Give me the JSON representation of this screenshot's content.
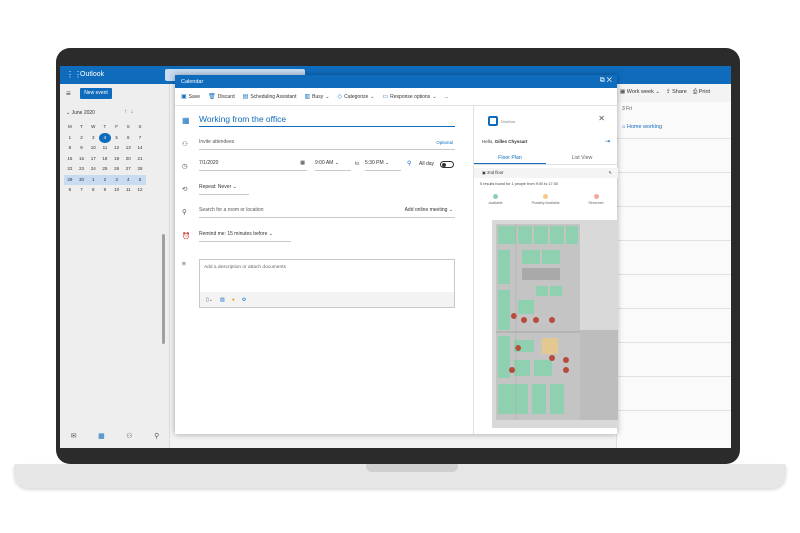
{
  "outlook": {
    "app_name": "Outlook",
    "new_event_label": "New event",
    "month_label": "June 2020",
    "weekdays": [
      "M",
      "T",
      "W",
      "T",
      "F",
      "S",
      "S"
    ],
    "weeks": [
      [
        "1",
        "2",
        "3",
        "4",
        "5",
        "6",
        "7"
      ],
      [
        "8",
        "9",
        "10",
        "11",
        "12",
        "13",
        "14"
      ],
      [
        "15",
        "16",
        "17",
        "18",
        "19",
        "20",
        "21"
      ],
      [
        "22",
        "23",
        "24",
        "25",
        "26",
        "27",
        "28"
      ],
      [
        "29",
        "30",
        "1",
        "2",
        "3",
        "4",
        "5"
      ],
      [
        "6",
        "7",
        "8",
        "9",
        "10",
        "11",
        "12"
      ]
    ],
    "today": "4",
    "view_label": "Work week",
    "share_label": "Share",
    "print_label": "Print",
    "day_label": "3 Fri",
    "home_working_label": "Home working"
  },
  "modal": {
    "window_title": "Calendar",
    "toolbar": {
      "save": "Save",
      "discard": "Discard",
      "scheduling": "Scheduling Assistant",
      "busy": "Busy",
      "categorize": "Categorize",
      "response": "Response options",
      "more": "..."
    },
    "form": {
      "title": "Working from the office",
      "attendees_placeholder": "Invite attendees",
      "optional_label": "Optional",
      "date": "7/1/2020",
      "start_time": "9:00 AM",
      "to_label": "to",
      "end_time": "5:30 PM",
      "all_day_label": "All day",
      "repeat_label": "Repeat: Never",
      "location_placeholder": "Search for a room or location",
      "online_meeting_label": "Add online meeting",
      "remind_label": "Remind me: 15 minutes before",
      "description_placeholder": "Add a description or attach documents"
    }
  },
  "panel": {
    "logo_text": "Deskflow",
    "greeting": "Hello,",
    "user_name": "Gilles Chyssart",
    "tabs": [
      "Floor Plan",
      "List View"
    ],
    "active_tab": 0,
    "floor_label": "2nd floor",
    "results_text": "5 results found for 1 people from 9:00 to 17:30",
    "legend": [
      {
        "label": "Available",
        "color": "#8fd0b0"
      },
      {
        "label": "Possibly Available",
        "color": "#f5c98a"
      },
      {
        "label": "Reserved",
        "color": "#f2a99a"
      }
    ],
    "zoom_in": "+",
    "zoom_out": "−"
  },
  "colors": {
    "accent": "#0f6cbd",
    "desk_available": "#8fd0b0",
    "desk_reserved": "#b84a3a"
  }
}
